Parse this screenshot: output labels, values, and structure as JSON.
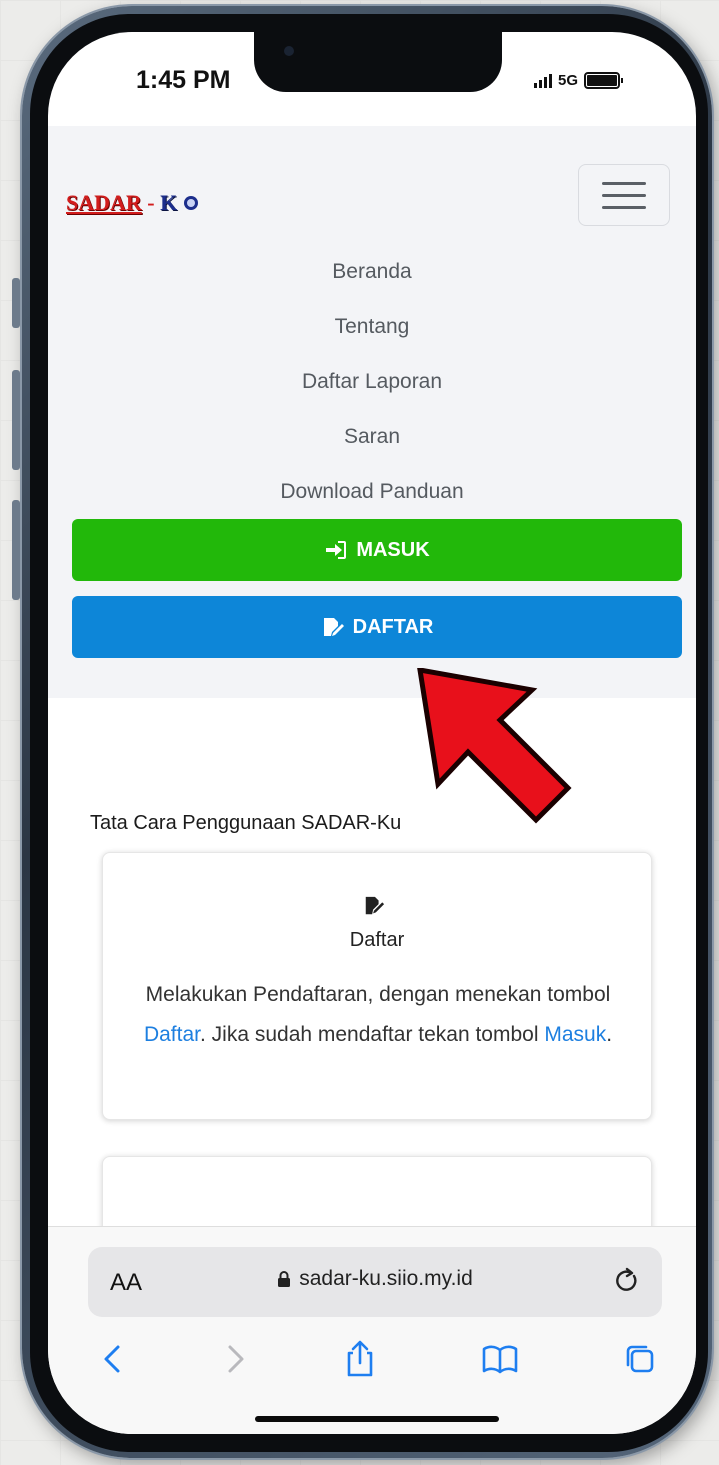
{
  "status_bar": {
    "time": "1:45 PM",
    "network": "5G"
  },
  "navbar": {
    "logo_part1": "SADAR",
    "logo_dash": "-",
    "logo_part2": "K",
    "menu": [
      "Beranda",
      "Tentang",
      "Daftar Laporan",
      "Saran",
      "Download Panduan"
    ],
    "login_label": "MASUK",
    "register_label": "DAFTAR"
  },
  "content": {
    "section_title": "Tata Cara Penggunaan SADAR-Ku",
    "card": {
      "title": "Daftar",
      "text_1": "Melakukan Pendaftaran, dengan menekan tombol ",
      "link_1": "Daftar",
      "text_2": ". Jika sudah mendaftar tekan tombol ",
      "link_2": "Masuk",
      "text_3": "."
    }
  },
  "browser": {
    "aa_label": "AA",
    "url": "sadar-ku.siio.my.id"
  },
  "colors": {
    "login_green": "#22b80a",
    "register_blue": "#0d86d8",
    "link_blue": "#1d7fe0",
    "arrow_red": "#e8101b"
  }
}
